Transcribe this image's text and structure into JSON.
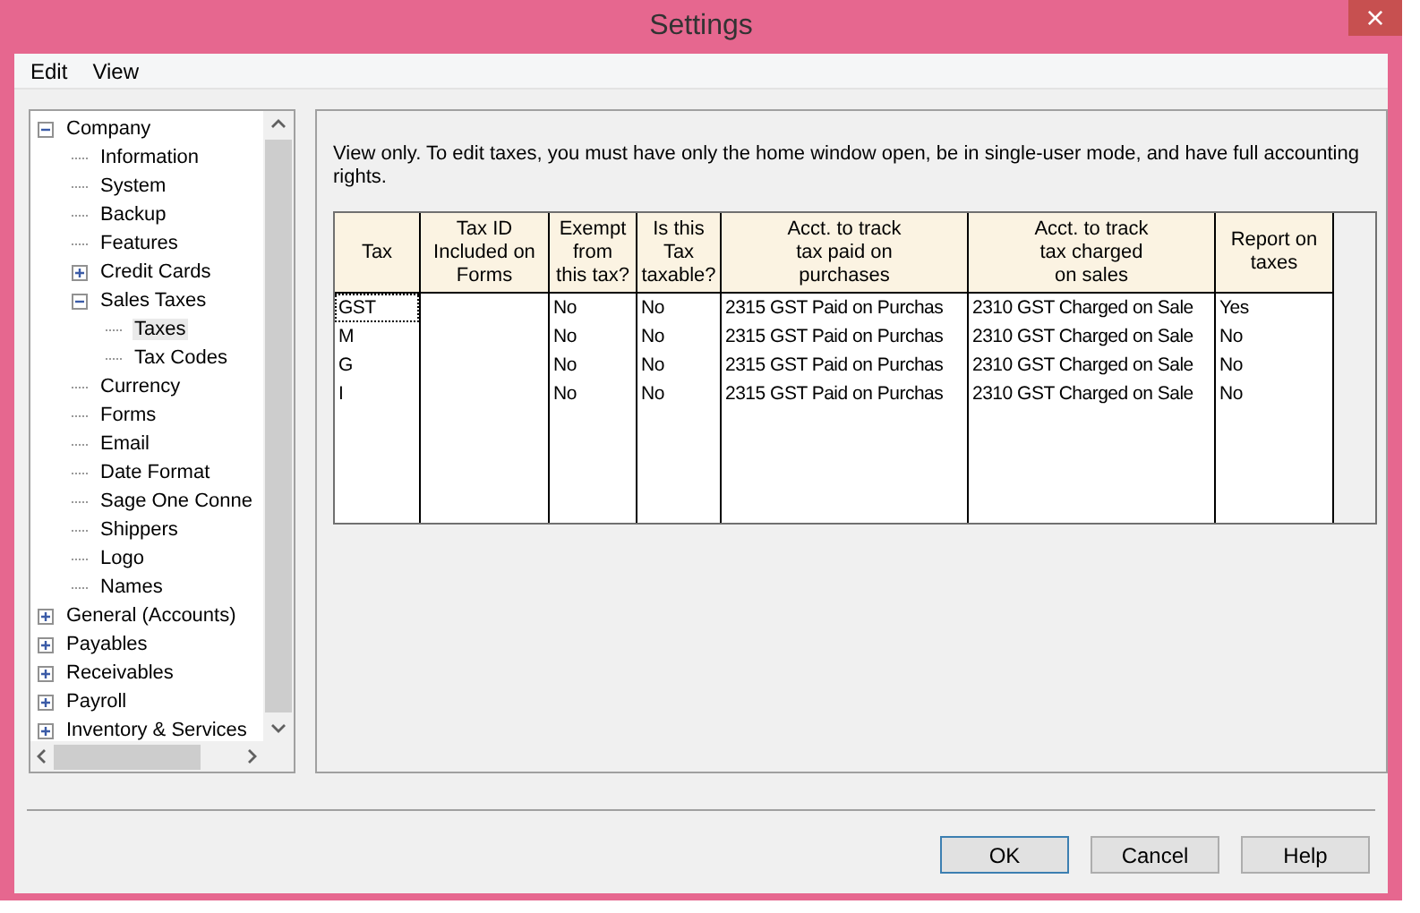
{
  "window": {
    "title": "Settings",
    "close": "×"
  },
  "menu": [
    "Edit",
    "View"
  ],
  "tree": [
    {
      "label": "Company",
      "expanded": true,
      "selected": false,
      "children": [
        {
          "label": "Information",
          "selected": false
        },
        {
          "label": "System",
          "selected": false
        },
        {
          "label": "Backup",
          "selected": false
        },
        {
          "label": "Features",
          "selected": false
        },
        {
          "label": "Credit Cards",
          "expanded": false,
          "selected": false
        },
        {
          "label": "Sales Taxes",
          "expanded": true,
          "selected": false,
          "children": [
            {
              "label": "Taxes",
              "selected": true
            },
            {
              "label": "Tax Codes",
              "selected": false
            }
          ]
        },
        {
          "label": "Currency",
          "selected": false
        },
        {
          "label": "Forms",
          "selected": false
        },
        {
          "label": "Email",
          "selected": false
        },
        {
          "label": "Date Format",
          "selected": false
        },
        {
          "label": "Sage One Conne",
          "selected": false
        },
        {
          "label": "Shippers",
          "selected": false
        },
        {
          "label": "Logo",
          "selected": false
        },
        {
          "label": "Names",
          "selected": false
        }
      ]
    },
    {
      "label": "General (Accounts)",
      "expanded": false,
      "selected": false
    },
    {
      "label": "Payables",
      "expanded": false,
      "selected": false
    },
    {
      "label": "Receivables",
      "expanded": false,
      "selected": false
    },
    {
      "label": "Payroll",
      "expanded": false,
      "selected": false
    },
    {
      "label": "Inventory & Services",
      "expanded": false,
      "selected": false
    }
  ],
  "notice": "View only. To edit taxes, you must have only the home window open, be in single-user mode, and have full accounting rights.",
  "table": {
    "columns": [
      "Tax",
      "Tax ID\nIncluded on\nForms",
      "Exempt\nfrom\nthis tax?",
      "Is this\nTax\ntaxable?",
      "Acct. to track\ntax paid on\npurchases",
      "Acct. to track\ntax charged\non sales",
      "Report on\ntaxes"
    ],
    "rows": [
      {
        "selected": true,
        "cells": [
          "GST",
          "",
          "No",
          "No",
          "2315 GST Paid on Purchas",
          "2310 GST Charged on Sale",
          "Yes"
        ]
      },
      {
        "selected": false,
        "cells": [
          "M",
          "",
          "No",
          "No",
          "2315 GST Paid on Purchas",
          "2310 GST Charged on Sale",
          "No"
        ]
      },
      {
        "selected": false,
        "cells": [
          "G",
          "",
          "No",
          "No",
          "2315 GST Paid on Purchas",
          "2310 GST Charged on Sale",
          "No"
        ]
      },
      {
        "selected": false,
        "cells": [
          "I",
          "",
          "No",
          "No",
          "2315 GST Paid on Purchas",
          "2310 GST Charged on Sale",
          "No"
        ]
      }
    ]
  },
  "buttons": [
    {
      "label": "OK",
      "default": true
    },
    {
      "label": "Cancel",
      "default": false
    },
    {
      "label": "Help",
      "default": false
    }
  ]
}
